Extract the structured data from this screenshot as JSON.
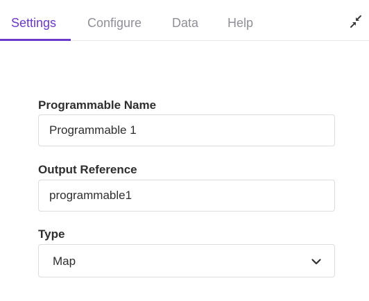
{
  "tabs": [
    {
      "label": "Settings",
      "active": true
    },
    {
      "label": "Configure",
      "active": false
    },
    {
      "label": "Data",
      "active": false
    },
    {
      "label": "Help",
      "active": false
    }
  ],
  "icons": {
    "collapse": "collapse-arrows-icon",
    "dropdown": "chevron-down-icon"
  },
  "colors": {
    "accent": "#6a39c9",
    "inactive_tab": "#8f8f98",
    "text": "#2e2e2e",
    "border": "#dcdce0"
  },
  "form": {
    "name": {
      "label": "Programmable Name",
      "value": "Programmable 1"
    },
    "output": {
      "label": "Output Reference",
      "value": "programmable1"
    },
    "type": {
      "label": "Type",
      "value": "Map"
    }
  }
}
